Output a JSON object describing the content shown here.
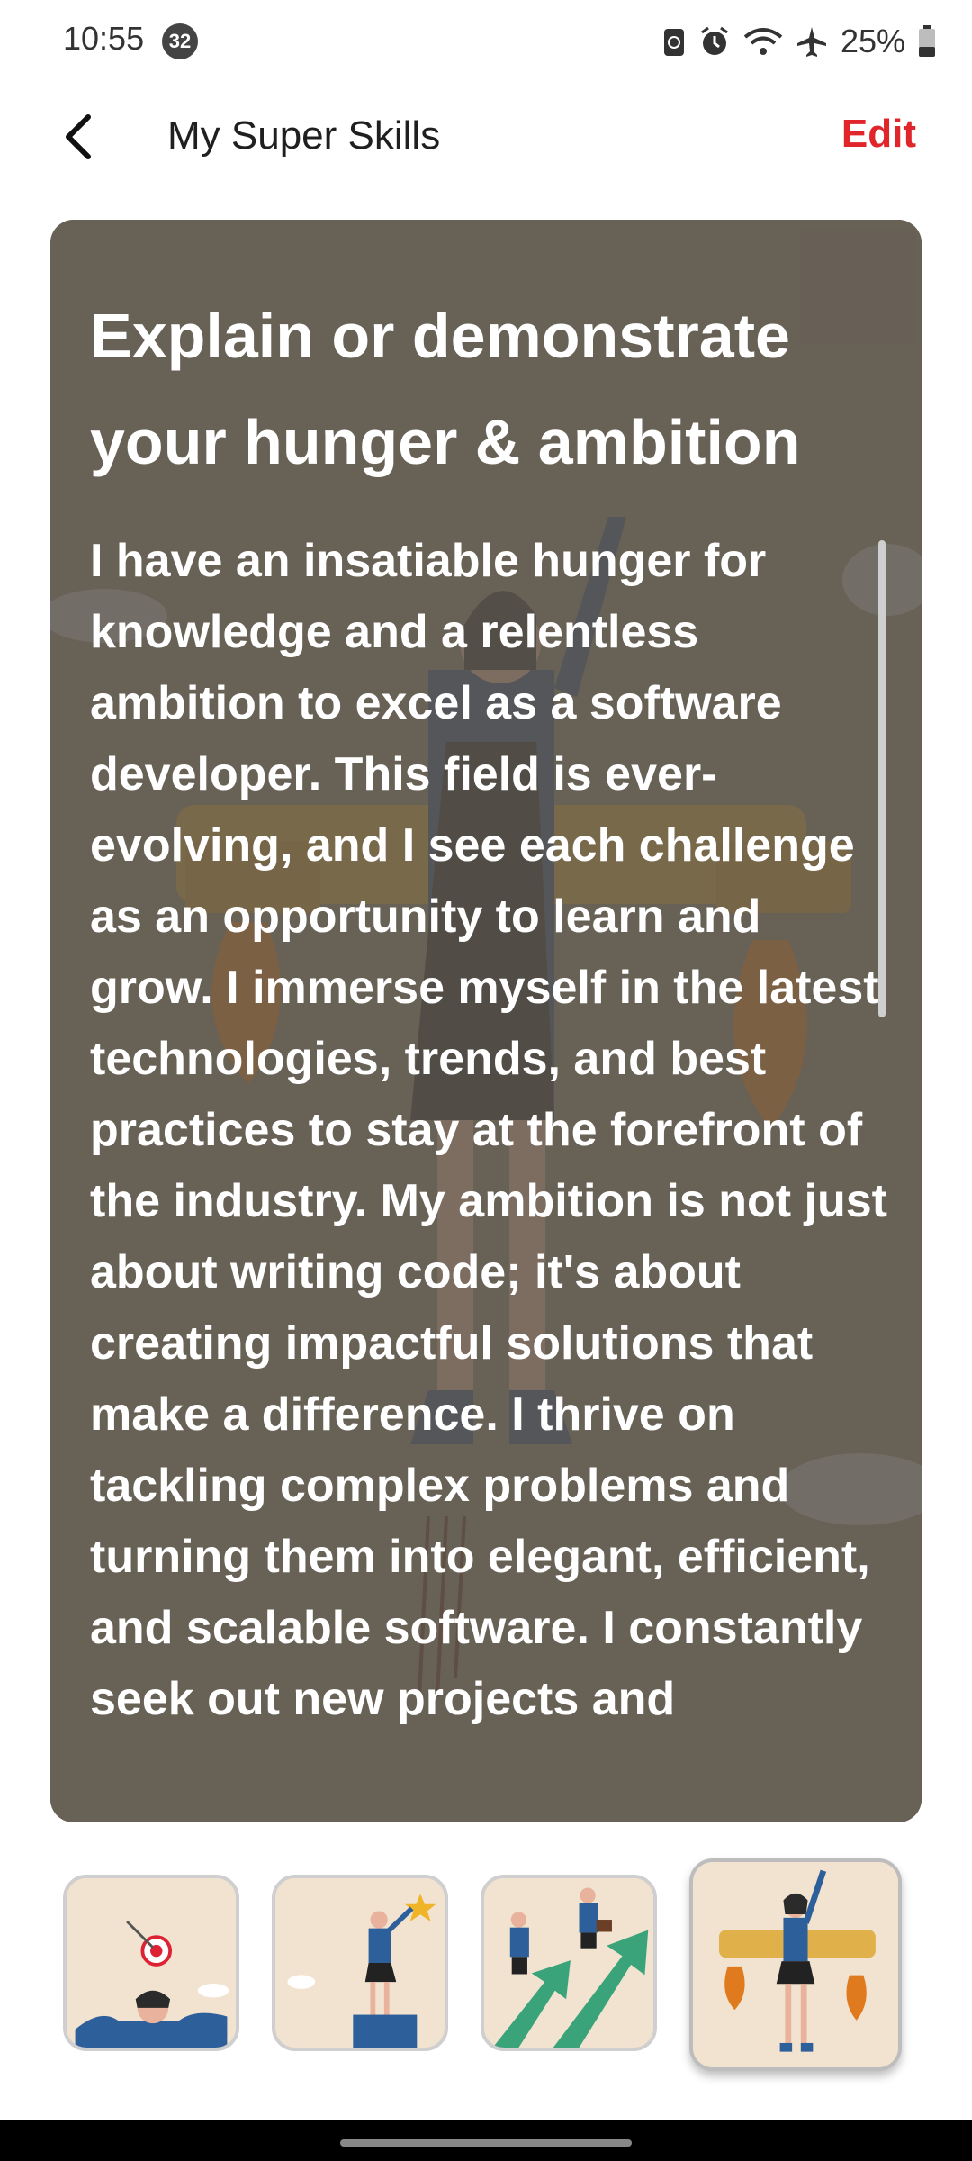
{
  "status_bar": {
    "time": "10:55",
    "notification_count": "32",
    "battery": "25%"
  },
  "header": {
    "title": "My Super Skills",
    "edit_label": "Edit",
    "accent_color": "#e0252b"
  },
  "card": {
    "title": "Explain or demonstrate your hunger & ambition",
    "body": "I have an insatiable hunger for knowledge and a relentless ambition to excel as a software developer. This field is ever-evolving, and I see each challenge as an opportunity to learn and grow. I immerse myself in the latest technologies, trends, and best practices to stay at the forefront of the industry. My ambition is not just about writing code; it's about creating impactful solutions that make a difference. I thrive on tackling complex problems and turning them into elegant, efficient, and scalable software. I constantly seek out new projects and"
  },
  "thumbnails": [
    {
      "icon": "target-illustration",
      "selected": false
    },
    {
      "icon": "climber-star-illustration",
      "selected": false
    },
    {
      "icon": "arrows-up-illustration",
      "selected": false
    },
    {
      "icon": "jetpack-woman-illustration",
      "selected": true
    }
  ]
}
